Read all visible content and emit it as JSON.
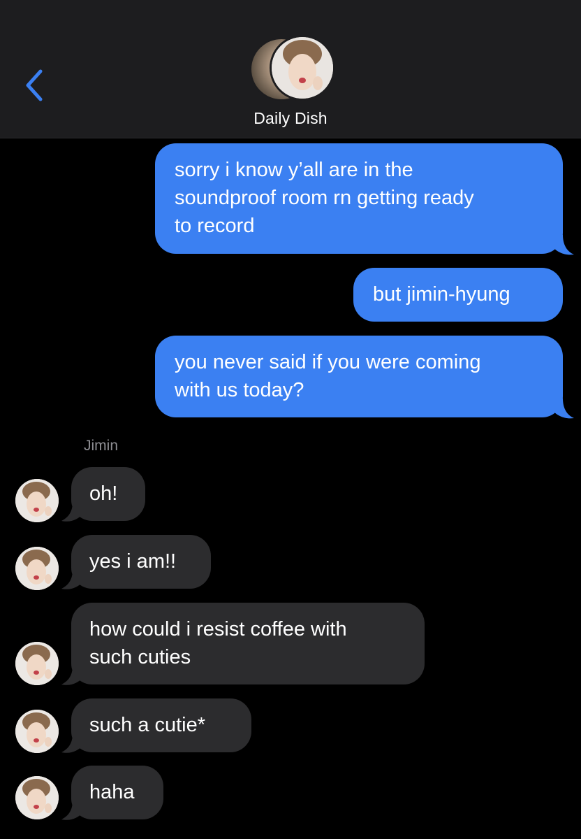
{
  "header": {
    "group_name": "Daily Dish"
  },
  "thread": {
    "outgoing": [
      "sorry i know y’all are in the\nsoundproof room rn getting ready\nto record",
      "but jimin-hyung",
      "you never said if you were coming\nwith us today?"
    ],
    "sender_name": "Jimin",
    "incoming": [
      "oh!",
      "yes i am!!",
      "how could i resist coffee with\nsuch cuties",
      "such a cutie*",
      "haha"
    ]
  },
  "colors": {
    "outgoing_bubble": "#3b80f2",
    "incoming_bubble": "#2c2c2e",
    "header_bg": "#1d1d1f",
    "accent": "#3b80f2",
    "background": "#000000"
  },
  "icons": {
    "back": "chevron-left-icon"
  }
}
